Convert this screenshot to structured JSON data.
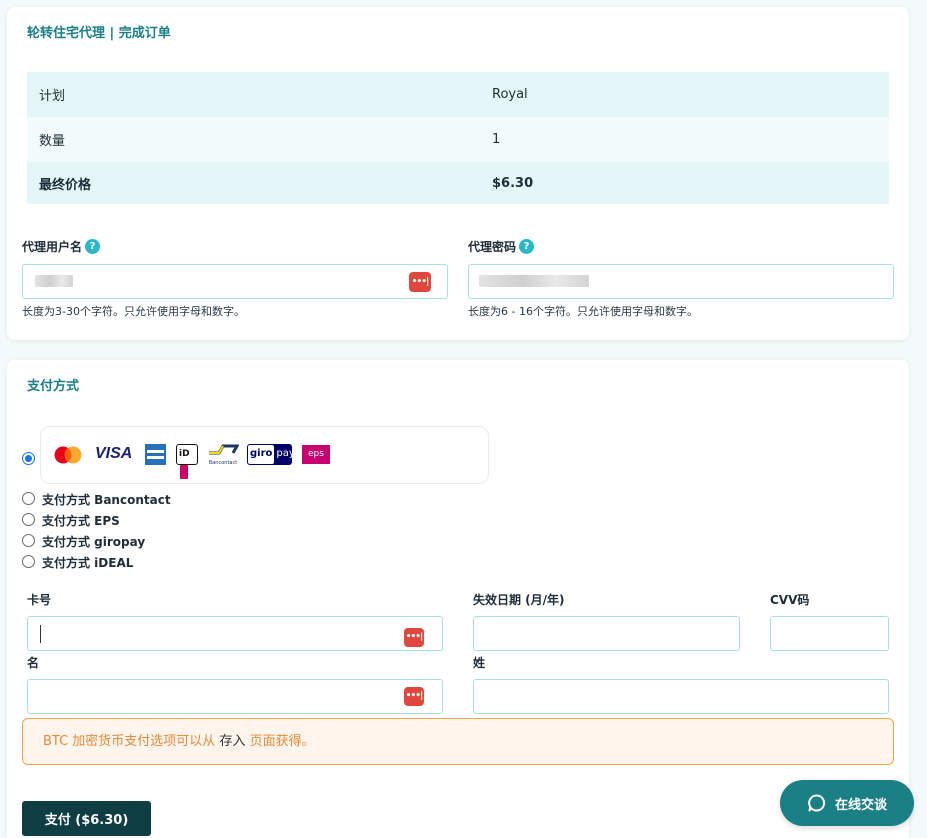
{
  "order": {
    "title": "轮转住宅代理 | 完成订单",
    "rows": [
      {
        "key": "计划",
        "value": "Royal"
      },
      {
        "key": "数量",
        "value": "1"
      },
      {
        "key": "最终价格",
        "value": "$6.30"
      }
    ],
    "username_label": "代理用户名",
    "password_label": "代理密码",
    "help_glyph": "?",
    "username_hint": "长度为3-30个字符。只允许使用字母和数字。",
    "password_hint": "长度为6 - 16个字符。只允许使用字母和数字。",
    "password_icon_glyph": "•••|"
  },
  "payment": {
    "title": "支付方式",
    "card_logos": [
      "mastercard-logo",
      "visa-logo",
      "amex-logo",
      "ideal-logo",
      "bancontact-logo",
      "giropay-logo",
      "eps-logo"
    ],
    "logo_text": {
      "visa": "VISA",
      "ideal": "iD",
      "bancontact": "Bancontact",
      "giro": "giro",
      "pay": "pay",
      "eps": "eps"
    },
    "methods": [
      {
        "label": "支付方式 Bancontact",
        "checked": false
      },
      {
        "label": "支付方式 EPS",
        "checked": false
      },
      {
        "label": "支付方式 giropay",
        "checked": false
      },
      {
        "label": "支付方式 iDEAL",
        "checked": false
      }
    ],
    "card_number_label": "卡号",
    "expiry_label": "失效日期 (月/年)",
    "cvv_label": "CVV码",
    "first_name_label": "名",
    "last_name_label": "姓",
    "notice_prefix": "BTC 加密货币支付选项可以从 ",
    "notice_link": "存入",
    "notice_suffix": " 页面获得。",
    "pay_button": "支付 ($6.30)"
  },
  "chat": {
    "label": "在线交谈"
  },
  "colors": {
    "accent": "#1b7f86",
    "button_dark": "#0f3d44",
    "notice_orange": "#e8893a",
    "password_icon_red": "#e0473d"
  }
}
